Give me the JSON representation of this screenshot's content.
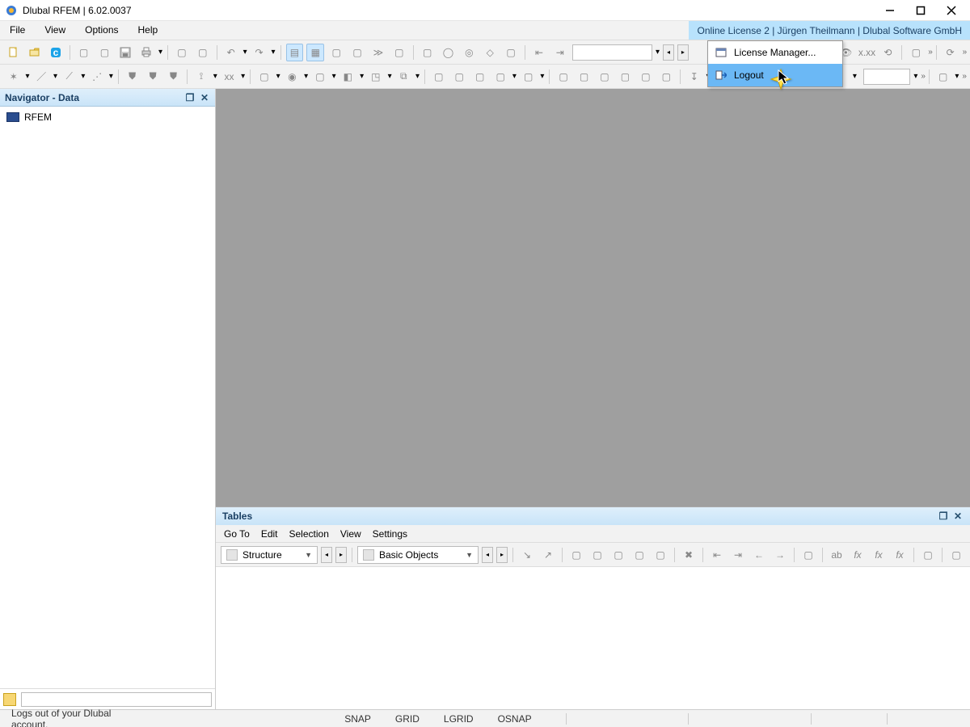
{
  "titlebar": {
    "title": "Dlubal RFEM | 6.02.0037"
  },
  "menu": {
    "file": "File",
    "view": "View",
    "options": "Options",
    "help": "Help"
  },
  "license_band": "Online License 2 | Jürgen Theilmann | Dlubal Software GmbH",
  "navigator": {
    "title": "Navigator - Data",
    "root": "RFEM"
  },
  "tables": {
    "title": "Tables",
    "menu": {
      "goto": "Go To",
      "edit": "Edit",
      "selection": "Selection",
      "view": "View",
      "settings": "Settings"
    },
    "combo1": "Structure",
    "combo2": "Basic Objects"
  },
  "dropdown": {
    "license_manager": "License Manager...",
    "logout": "Logout"
  },
  "statusbar": {
    "hint": "Logs out of your Dlubal account.",
    "snap": "SNAP",
    "grid": "GRID",
    "lgrid": "LGRID",
    "osnap": "OSNAP"
  }
}
